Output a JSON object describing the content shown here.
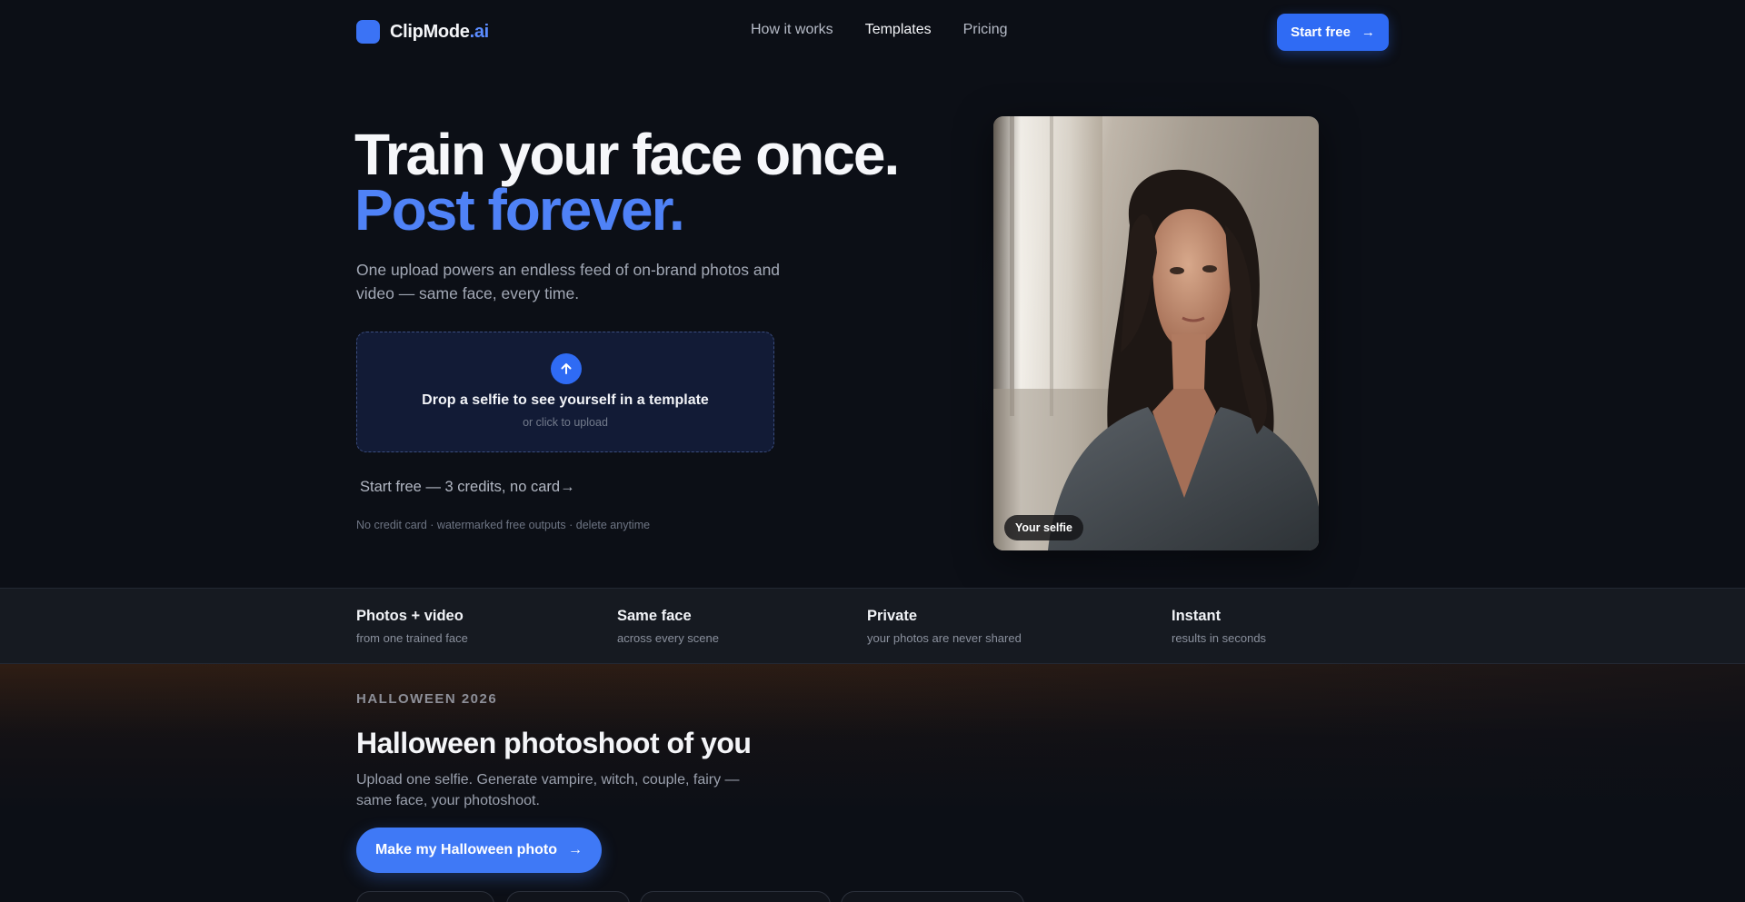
{
  "nav": {
    "logo_text": "ClipMode",
    "logo_accent": ".ai",
    "links": [
      "How it works",
      "Templates",
      "Pricing"
    ],
    "active_link": "Templates",
    "cta_label": "Start free",
    "cta_arrow": "→"
  },
  "hero": {
    "title_line1": "Train your face once.",
    "title_line2": "Post forever.",
    "subtitle": "One upload powers an endless feed of on-brand photos and video — same face, every time.",
    "dropzone_title": "Drop a selfie to see yourself in a template",
    "dropzone_sub": "or click to upload",
    "cta_link": "Start free — 3 credits, no card→",
    "fine_print": "No credit card · watermarked free outputs · delete anytime",
    "photo_badge": "Your selfie"
  },
  "features": [
    {
      "title": "Photos + video",
      "sub": "from one trained face"
    },
    {
      "title": "Same face",
      "sub": "across every scene"
    },
    {
      "title": "Private",
      "sub": "your photos are never shared"
    },
    {
      "title": "Instant",
      "sub": "results in seconds"
    }
  ],
  "halloween": {
    "eyebrow": "HALLOWEEN 2026",
    "title": "Halloween photoshoot of you",
    "subtitle": "Upload one selfie. Generate vampire, witch, couple, fairy — same face, your photoshoot.",
    "cta_label": "Make my Halloween photo",
    "cta_arrow": "→"
  },
  "colors": {
    "background": "#0c0f16",
    "accent": "#2f6bf4",
    "accent_text": "#4f82f7"
  },
  "icons": [
    "moon-icon",
    "arrow-up-icon",
    "arrow-right-icon"
  ]
}
